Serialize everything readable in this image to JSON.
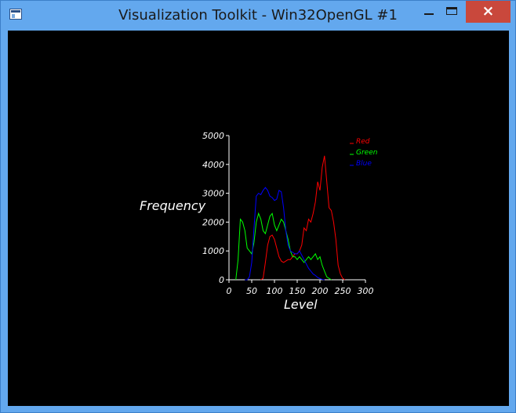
{
  "window": {
    "title": "Visualization Toolkit - Win32OpenGL #1",
    "close_glyph": "×",
    "icons": {
      "app": "vtk-app-icon",
      "minimize": "minimize-icon",
      "maximize": "maximize-icon",
      "close": "close-icon"
    }
  },
  "chart_data": {
    "type": "line",
    "xlabel": "Level",
    "ylabel": "Frequency",
    "xlim": [
      0,
      300
    ],
    "ylim": [
      0,
      5000
    ],
    "x_ticks": [
      "0",
      "50",
      "100",
      "150",
      "200",
      "250",
      "300"
    ],
    "y_ticks": [
      "0",
      "1000",
      "2000",
      "3000",
      "4000",
      "5000"
    ],
    "legend_placement": "top-right",
    "series": [
      {
        "name": "Red",
        "color": "#ff0000",
        "x": [
          70,
          75,
          80,
          85,
          90,
          95,
          100,
          105,
          110,
          115,
          120,
          125,
          130,
          135,
          140,
          145,
          150,
          155,
          160,
          165,
          170,
          175,
          180,
          185,
          190,
          195,
          200,
          205,
          210,
          215,
          220,
          225,
          230,
          235,
          240,
          245,
          250,
          255
        ],
        "y": [
          0,
          50,
          600,
          1200,
          1500,
          1550,
          1400,
          1100,
          800,
          650,
          600,
          650,
          700,
          700,
          800,
          900,
          900,
          1000,
          1200,
          1800,
          1700,
          2100,
          2000,
          2300,
          2700,
          3400,
          3100,
          3900,
          4300,
          3400,
          2500,
          2400,
          2000,
          1400,
          500,
          200,
          50,
          0
        ]
      },
      {
        "name": "Green",
        "color": "#00ff00",
        "x": [
          15,
          20,
          25,
          30,
          35,
          40,
          45,
          50,
          55,
          60,
          65,
          70,
          75,
          80,
          85,
          90,
          95,
          100,
          105,
          110,
          115,
          120,
          125,
          130,
          135,
          140,
          145,
          150,
          155,
          160,
          165,
          170,
          175,
          180,
          185,
          190,
          195,
          200,
          205,
          210,
          215,
          220,
          225
        ],
        "y": [
          0,
          700,
          2100,
          2000,
          1700,
          1100,
          1000,
          900,
          1300,
          2000,
          2300,
          2100,
          1700,
          1600,
          1900,
          2200,
          2300,
          1900,
          1700,
          1900,
          2100,
          2000,
          1700,
          1400,
          1000,
          800,
          800,
          700,
          800,
          700,
          600,
          700,
          800,
          700,
          800,
          900,
          700,
          800,
          500,
          300,
          100,
          50,
          0
        ]
      },
      {
        "name": "Blue",
        "color": "#0000ff",
        "x": [
          35,
          40,
          45,
          50,
          55,
          60,
          65,
          70,
          75,
          80,
          85,
          90,
          95,
          100,
          105,
          110,
          115,
          120,
          125,
          130,
          135,
          140,
          145,
          150,
          155,
          160,
          165,
          170,
          175,
          180,
          185,
          190,
          195,
          200,
          205,
          210
        ],
        "y": [
          0,
          0,
          100,
          600,
          1800,
          2900,
          3000,
          2950,
          3100,
          3200,
          3100,
          2900,
          2850,
          2750,
          2800,
          3100,
          3050,
          2500,
          1700,
          1200,
          1000,
          950,
          900,
          900,
          1000,
          850,
          700,
          550,
          400,
          300,
          200,
          150,
          80,
          40,
          10,
          0
        ]
      }
    ]
  }
}
